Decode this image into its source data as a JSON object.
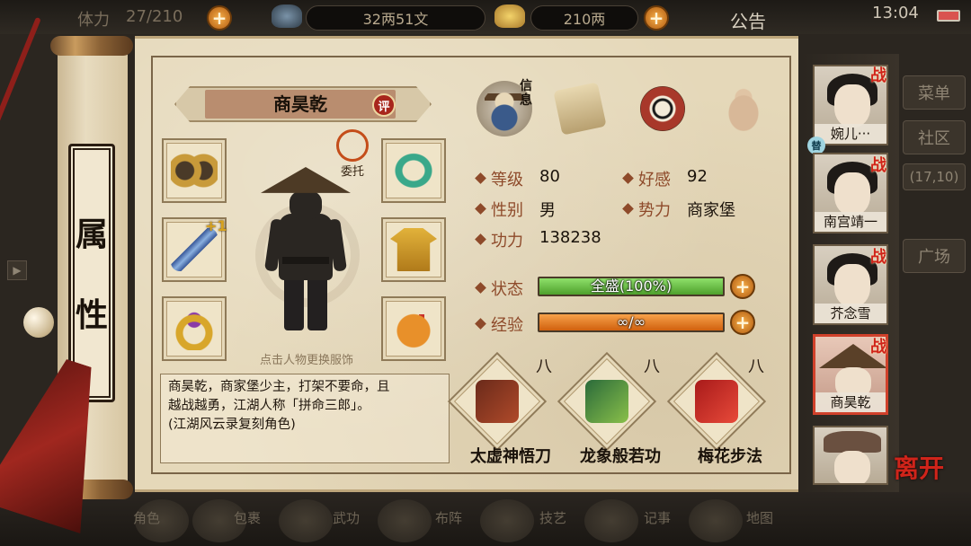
{
  "topbar": {
    "stamina": "27/210",
    "copper": "32两51文",
    "silver": "210两",
    "notice_label": "公告",
    "time": "13:04"
  },
  "background": {
    "side_buttons": [
      "菜单",
      "社区",
      "(17,10)",
      "广场"
    ],
    "bottom_labels": [
      "角色",
      "包裹",
      "武功",
      "布阵",
      "技艺",
      "记事",
      "地图"
    ]
  },
  "scroll": {
    "title_chars": [
      "属",
      "性"
    ]
  },
  "character": {
    "name": "商昊乾",
    "rating_badge": "评",
    "commission_label": "委托",
    "change_outfit_hint": "点击人物更换服饰",
    "weapon_bonus": "+1",
    "bio_lines": [
      "商昊乾，商家堡少主，打架不要命，且",
      "越战越勇，江湖人称「拼命三郎」。",
      "(江湖风云录复刻角色)"
    ]
  },
  "equipment": [
    {
      "slot": "accessory",
      "icon": "binoculars-icon"
    },
    {
      "slot": "weapon",
      "icon": "spear-icon"
    },
    {
      "slot": "ring",
      "icon": "ring-icon"
    },
    {
      "slot": "belt",
      "icon": "jade-belt-icon"
    },
    {
      "slot": "armor",
      "icon": "golden-robe-icon"
    },
    {
      "slot": "pendant",
      "icon": "pouch-icon"
    }
  ],
  "tabs": [
    {
      "id": "info",
      "label": "信息",
      "icon": "info-portrait-icon"
    },
    {
      "id": "intel",
      "icon": "scroll-map-icon"
    },
    {
      "id": "bagua",
      "icon": "bagua-icon"
    },
    {
      "id": "meridian",
      "icon": "meridian-body-icon"
    }
  ],
  "stats": {
    "level_label": "等级",
    "level": "80",
    "favor_label": "好感",
    "favor": "92",
    "gender_label": "性别",
    "gender": "男",
    "faction_label": "势力",
    "faction": "商家堡",
    "power_label": "功力",
    "power": "138238"
  },
  "bars": {
    "status_label": "状态",
    "status_text": "全盛(100%)",
    "status_fraction": 1.0,
    "exp_label": "经验",
    "exp_text": "∞/∞",
    "exp_fraction": 1.0
  },
  "skills": [
    {
      "name": "太虚神悟刀",
      "rank": "八",
      "icon": "saber-manual-icon"
    },
    {
      "name": "龙象般若功",
      "rank": "八",
      "icon": "green-robe-manual-icon"
    },
    {
      "name": "梅花步法",
      "rank": "八",
      "icon": "red-book-icon"
    }
  ],
  "party": [
    {
      "name": "婉儿···",
      "battle_mark": "战",
      "selected": false
    },
    {
      "name": "南宫靖一",
      "battle_mark": "战",
      "selected": false
    },
    {
      "name": "芥念雪",
      "battle_mark": "战",
      "selected": false
    },
    {
      "name": "商昊乾",
      "battle_mark": "战",
      "selected": true
    },
    {
      "name": "",
      "battle_mark": "",
      "selected": false
    }
  ],
  "sub_tag": "替",
  "leave_label": "离开",
  "colors": {
    "status_bar": "#6cc24a",
    "exp_bar": "#e87a1e",
    "accent_red": "#d0241a",
    "stat_label": "#8e4a2a"
  }
}
